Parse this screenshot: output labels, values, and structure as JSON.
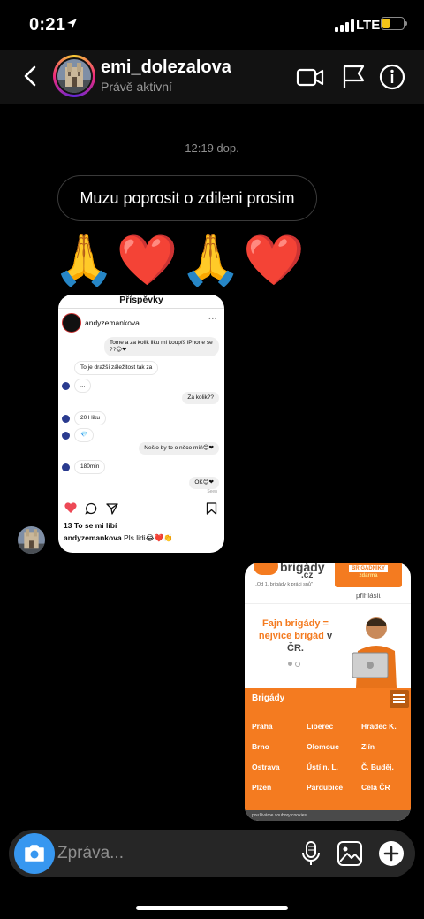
{
  "status_bar": {
    "time": "0:21",
    "network": "LTE",
    "battery_level": 0.35,
    "battery_color": "#f5c518",
    "location_icon": "location-arrow-icon"
  },
  "header": {
    "username": "emi_dolezalova",
    "presence": "Právě aktivní",
    "icons": [
      "back-chevron-icon",
      "video-call-icon",
      "flag-icon",
      "info-icon"
    ]
  },
  "chat": {
    "timestamp": "12:19 dop.",
    "message_text": "Muzu poprosit o zdileni prosim",
    "emojis": "🙏❤️🙏❤️",
    "shared_posts_screenshot": {
      "title": "Příspěvky",
      "account": "andyzemankova",
      "messages": [
        {
          "side": "right",
          "text": "Tome a za kolik liku mi koupíš iPhone se ??😊❤"
        },
        {
          "side": "left",
          "text": "To je dražší záležitost tak za"
        },
        {
          "side": "left",
          "text": "..."
        },
        {
          "side": "right",
          "text": "Za kolik??"
        },
        {
          "side": "left",
          "text": "20 l liku"
        },
        {
          "side": "left",
          "text": "💎"
        },
        {
          "side": "right",
          "text": "Nešlo by to o něco míň😊❤"
        },
        {
          "side": "left",
          "text": "180min"
        },
        {
          "side": "right",
          "text": "OK😊❤"
        },
        {
          "side": "right",
          "text": "Seen"
        }
      ],
      "likes": "13 To se mi líbí",
      "caption_user": "andyzemankova",
      "caption_text": "Pls lidi😂❤️👏"
    },
    "website_screenshot": {
      "logo": "brigády",
      "logo_domain": ".cz",
      "tagline": "„Od 1. brigády k práci snů\"",
      "cta_line1": "BRIGÁDNÍKY",
      "cta_line2": "zdarma",
      "login": "přihlásit",
      "headline_orange": "Fajn brigády =",
      "headline_orange2": "nejvíce brigád",
      "headline_tail": "v",
      "headline_dark": "ČR.",
      "section": "Brigády",
      "cities": [
        "Praha",
        "Liberec",
        "Hradec K.",
        "Brno",
        "Olomouc",
        "Zlín",
        "Ostrava",
        "Ústí n. L.",
        "Č. Buděj.",
        "Plzeň",
        "Pardubice",
        "Celá ČR"
      ],
      "footer": "používáme soubory cookies"
    }
  },
  "composer": {
    "placeholder": "Zpráva...",
    "icons": [
      "camera-icon",
      "microphone-icon",
      "gallery-icon",
      "plus-icon"
    ]
  },
  "colors": {
    "background": "#000000",
    "header": "#121212",
    "composer": "#262626",
    "camera_button": "#3797f0",
    "brand_orange": "#f47b20"
  }
}
